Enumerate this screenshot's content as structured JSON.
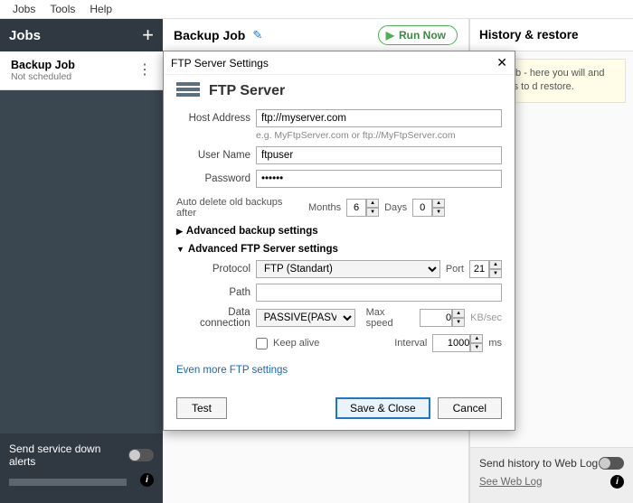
{
  "menu": {
    "jobs": "Jobs",
    "tools": "Tools",
    "help": "Help"
  },
  "sidebar": {
    "title": "Jobs",
    "job": {
      "name": "Backup Job",
      "status": "Not scheduled"
    },
    "alerts_label": "Send service down alerts"
  },
  "center": {
    "title": "Backup Job",
    "run_label": "Run Now"
  },
  "right": {
    "title": "History & restore",
    "hint": "your job - here you will\n and buttons to\nd restore.",
    "send_label": "Send history to Web Log",
    "link": "See Web Log"
  },
  "modal": {
    "title": "FTP Server Settings",
    "heading": "FTP Server",
    "host_label": "Host Address",
    "host_value": "ftp://myserver.com",
    "host_hint": "e.g. MyFtpServer.com or ftp://MyFtpServer.com",
    "user_label": "User Name",
    "user_value": "ftpuser",
    "pass_label": "Password",
    "pass_value": "••••••",
    "auto_delete_label": "Auto delete old backups after",
    "months_label": "Months",
    "months_value": "6",
    "days_label": "Days",
    "days_value": "0",
    "adv_backup": "Advanced backup settings",
    "adv_ftp": "Advanced FTP Server settings",
    "protocol_label": "Protocol",
    "protocol_value": "FTP (Standart)",
    "port_label": "Port",
    "port_value": "21",
    "path_label": "Path",
    "path_value": "",
    "dataconn_label": "Data connection",
    "dataconn_value": "PASSIVE(PASV)",
    "maxspeed_label": "Max speed",
    "maxspeed_value": "0",
    "maxspeed_unit": "KB/sec",
    "keepalive_label": "Keep alive",
    "interval_label": "Interval",
    "interval_value": "1000",
    "interval_unit": "ms",
    "more_link": "Even more FTP settings",
    "test": "Test",
    "save": "Save & Close",
    "cancel": "Cancel"
  }
}
